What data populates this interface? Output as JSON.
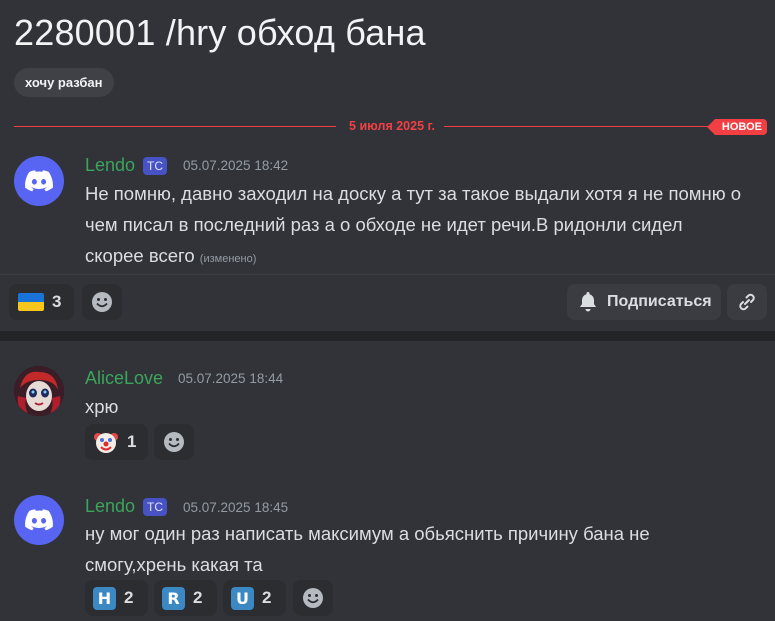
{
  "thread": {
    "title": "2280001 /hry обход бана",
    "tag": "хочу разбан"
  },
  "divider": {
    "date": "5 июля 2025 г.",
    "new_label": "НОВОЕ"
  },
  "messages": [
    {
      "username": "Lendo",
      "badge": "ТС",
      "timestamp": "05.07.2025 18:42",
      "lines": [
        "Не помню, давно заходил на доску а тут за такое выдали хотя я не помню о",
        "чем писал в последний раз а о обходе не идет речи.В ридонли сидел",
        "скорее всего"
      ],
      "edited": "(изменено)",
      "avatar": "discord-logo-icon"
    },
    {
      "username": "AliceLove",
      "timestamp": "05.07.2025 18:44",
      "lines": [
        "хрю"
      ],
      "avatar": "alice-avatar"
    },
    {
      "username": "Lendo",
      "badge": "ТС",
      "timestamp": "05.07.2025 18:45",
      "lines": [
        "ну мог один раз написать максимум а обьяснить причину бана не",
        "смогу,хрень какая та"
      ],
      "avatar": "discord-logo-icon"
    }
  ],
  "thread_footer": {
    "reaction": {
      "icon": "ukraine-flag-icon",
      "count": "3"
    },
    "subscribe_label": "Подписаться"
  },
  "reactions": {
    "alice": [
      {
        "icon": "clown-face-icon",
        "count": "1"
      }
    ],
    "lendo2": [
      {
        "letter": "H",
        "count": "2"
      },
      {
        "letter": "R",
        "count": "2"
      },
      {
        "letter": "U",
        "count": "2"
      }
    ]
  },
  "colors": {
    "background": "#313338",
    "username": "#3ba55c",
    "new_divider": "#f23f43",
    "discord_blurple": "#5865f2"
  }
}
